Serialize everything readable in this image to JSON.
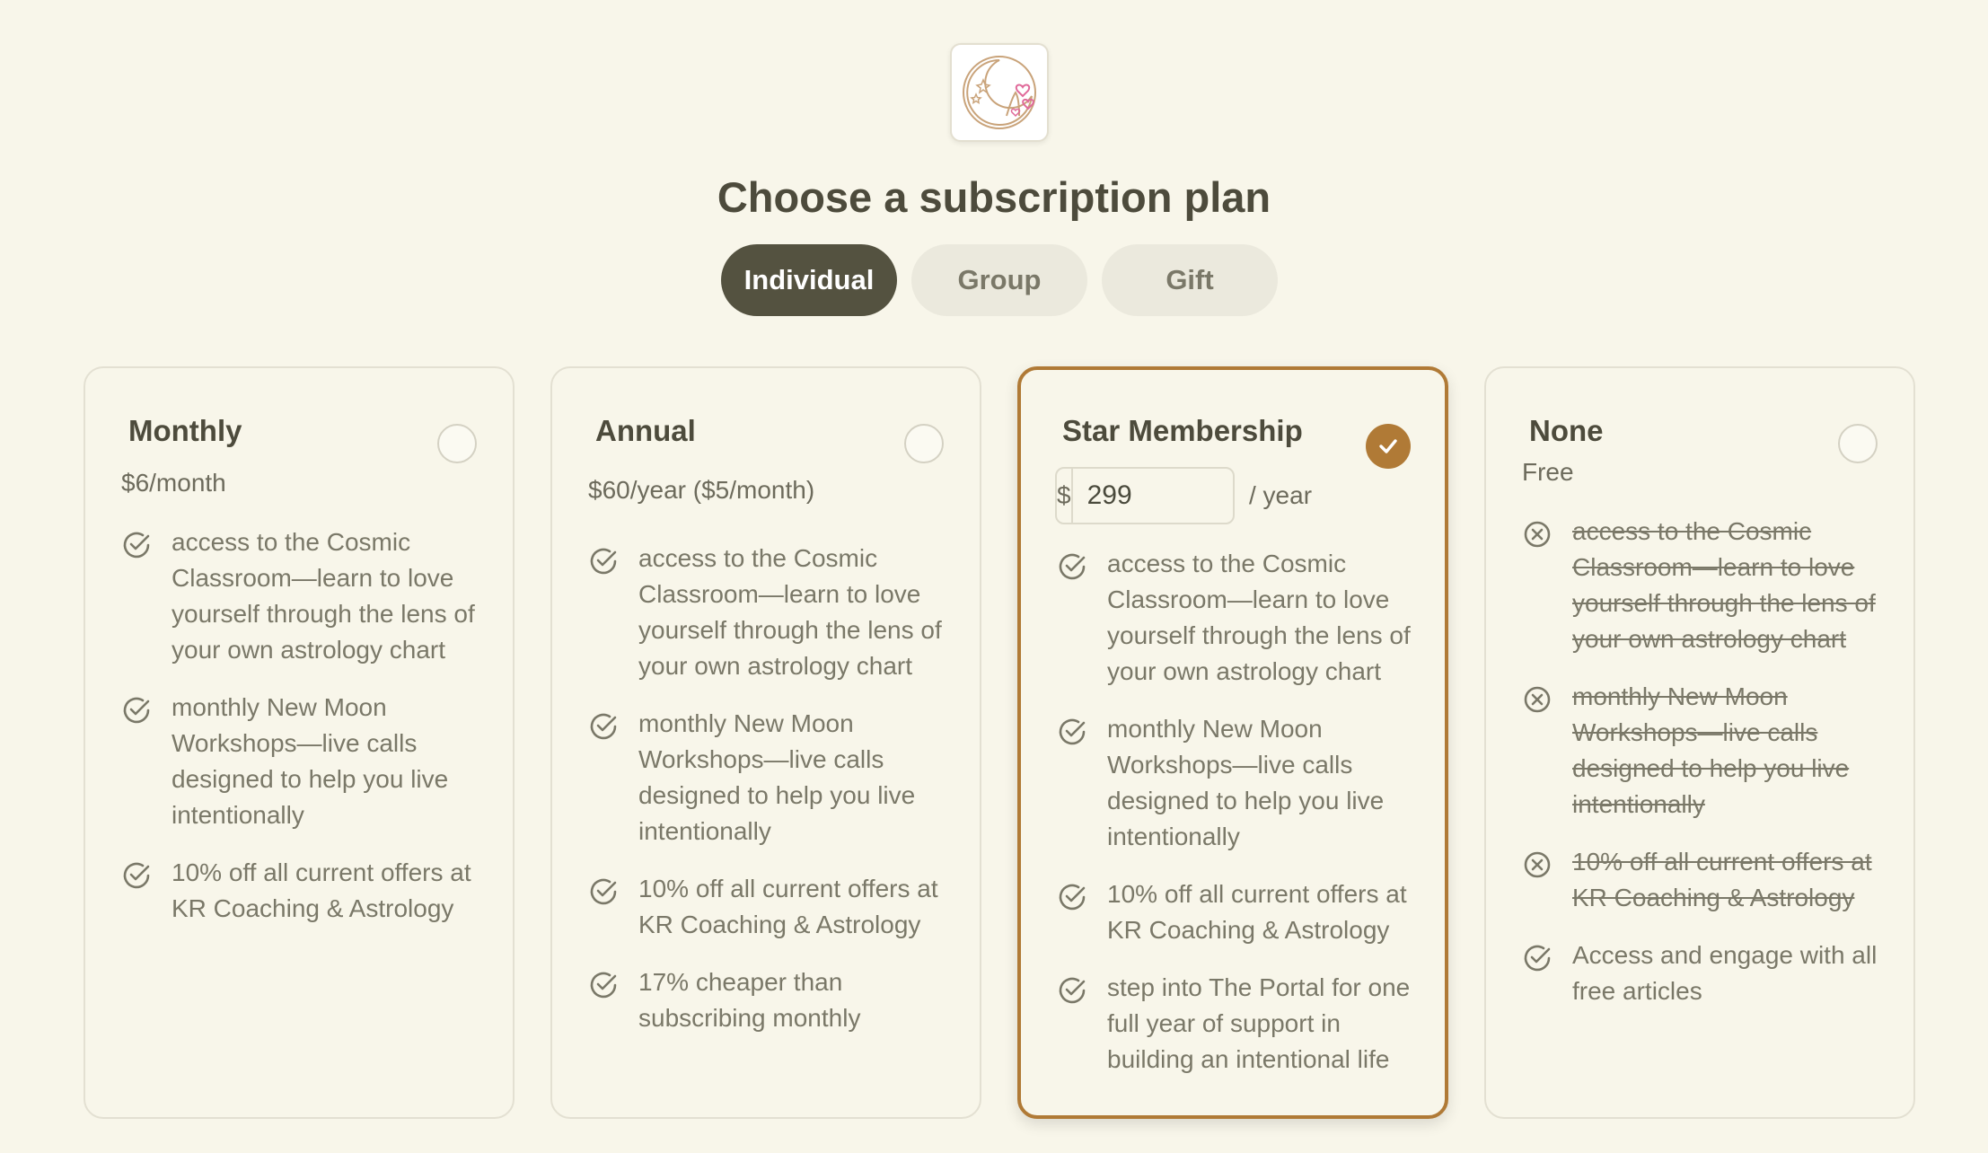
{
  "header": {
    "title": "Choose a subscription plan",
    "logo_icon": "crescent-moon-astrology-logo"
  },
  "tabs": [
    {
      "label": "Individual",
      "active": true
    },
    {
      "label": "Group",
      "active": false
    },
    {
      "label": "Gift",
      "active": false
    }
  ],
  "colors": {
    "background": "#f8f6ea",
    "accent": "#b07a36",
    "active_tab": "#545240"
  },
  "plans": [
    {
      "name": "Monthly",
      "price": "$6/month",
      "selected": false,
      "features": [
        {
          "text": "access to the Cosmic Classroom—learn to love yourself through the lens of your own astrology chart",
          "included": true
        },
        {
          "text": "monthly New Moon Workshops—live calls designed to help you live intentionally",
          "included": true
        },
        {
          "text": "10% off all current offers at KR Coaching & Astrology",
          "included": true
        }
      ]
    },
    {
      "name": "Annual",
      "price": "$60/year ($5/month)",
      "selected": false,
      "features": [
        {
          "text": "access to the Cosmic Classroom—learn to love yourself through the lens of your own astrology chart",
          "included": true
        },
        {
          "text": "monthly New Moon Workshops—live calls designed to help you live intentionally",
          "included": true
        },
        {
          "text": "10% off all current offers at KR Coaching & Astrology",
          "included": true
        },
        {
          "text": "17% cheaper than subscribing monthly",
          "included": true
        }
      ]
    },
    {
      "name": "Star Membership",
      "currency": "$",
      "price_value": "299",
      "price_unit": "/ year",
      "selected": true,
      "features": [
        {
          "text": "access to the Cosmic Classroom—learn to love yourself through the lens of your own astrology chart",
          "included": true
        },
        {
          "text": "monthly New Moon Workshops—live calls designed to help you live intentionally",
          "included": true
        },
        {
          "text": "10% off all current offers at KR Coaching & Astrology",
          "included": true
        },
        {
          "text": "step into The Portal for one full year of support in building an intentional life",
          "included": true
        }
      ]
    },
    {
      "name": "None",
      "price": "Free",
      "selected": false,
      "features": [
        {
          "text": "access to the Cosmic Classroom—learn to love yourself through the lens of your own astrology chart",
          "included": false
        },
        {
          "text": "monthly New Moon Workshops—live calls designed to help you live intentionally",
          "included": false
        },
        {
          "text": "10% off all current offers at KR Coaching & Astrology",
          "included": false
        },
        {
          "text": "Access and engage with all free articles",
          "included": true
        }
      ]
    }
  ]
}
